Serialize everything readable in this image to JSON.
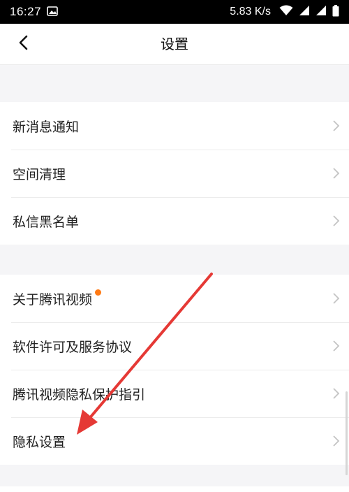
{
  "status_bar": {
    "time": "16:27",
    "network_speed": "5.83 K/s",
    "icons": [
      "image-icon",
      "wifi-icon",
      "signal-icon",
      "signal-icon",
      "battery-icon"
    ]
  },
  "header": {
    "title": "设置",
    "back_icon": "chevron-left-icon"
  },
  "sections": [
    {
      "items": [
        {
          "label": "新消息通知"
        },
        {
          "label": "空间清理"
        },
        {
          "label": "私信黑名单"
        }
      ]
    },
    {
      "items": [
        {
          "label": "关于腾讯视频",
          "badge": true
        },
        {
          "label": "软件许可及服务协议"
        },
        {
          "label": "腾讯视频隐私保护指引"
        },
        {
          "label": "隐私设置"
        }
      ]
    }
  ],
  "colors": {
    "status_bar_bg": "#000000",
    "page_bg": "#f5f5f7",
    "badge": "#ff7a14",
    "annotation_arrow": "#e53935"
  }
}
